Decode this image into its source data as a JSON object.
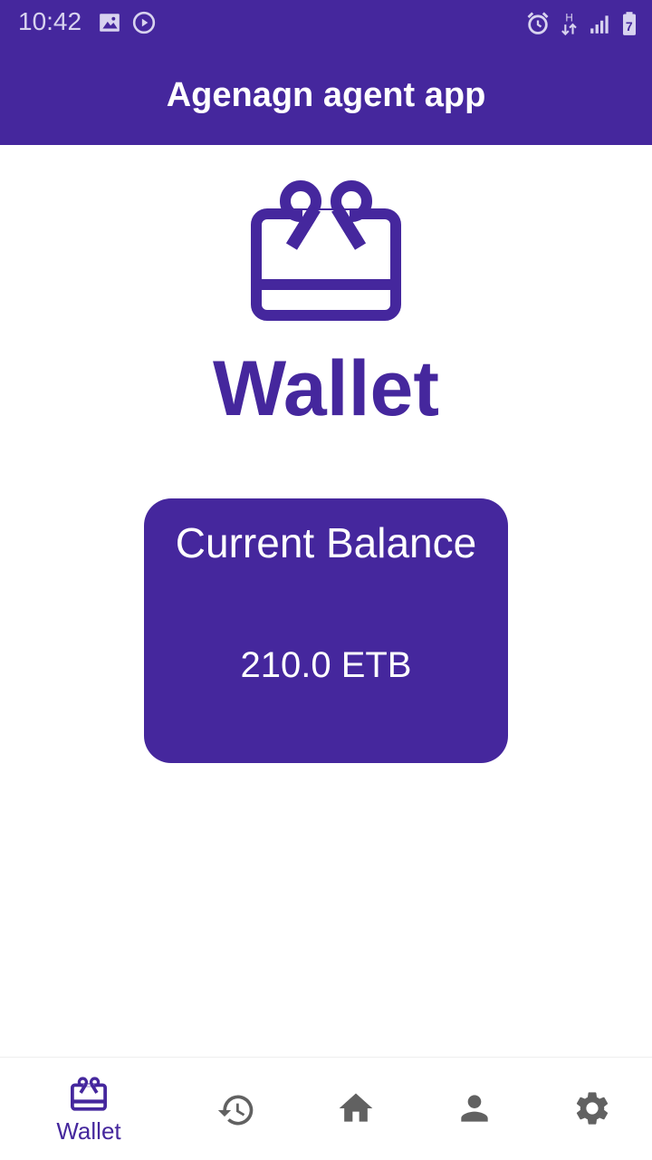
{
  "status_bar": {
    "time": "10:42",
    "left_icons": [
      "image-icon",
      "play-circle-icon"
    ],
    "right_icons": [
      "alarm-icon",
      "data-arrows-icon",
      "signal-icon",
      "battery-icon"
    ],
    "network_label": "H",
    "battery_level": "7"
  },
  "app_bar": {
    "title": "Agenagn agent app"
  },
  "main": {
    "icon": "wallet-gift-icon",
    "heading": "Wallet",
    "balance_card": {
      "label": "Current Balance",
      "value": "210.0 ETB"
    }
  },
  "bottom_nav": {
    "items": [
      {
        "icon": "wallet-gift-icon",
        "label": "Wallet",
        "active": true
      },
      {
        "icon": "history-icon",
        "label": "",
        "active": false
      },
      {
        "icon": "home-icon",
        "label": "",
        "active": false
      },
      {
        "icon": "person-icon",
        "label": "",
        "active": false
      },
      {
        "icon": "settings-icon",
        "label": "",
        "active": false
      }
    ]
  },
  "colors": {
    "primary": "#45279d",
    "on_primary": "#ffffff",
    "inactive_icon": "#616161",
    "background": "#ffffff"
  }
}
